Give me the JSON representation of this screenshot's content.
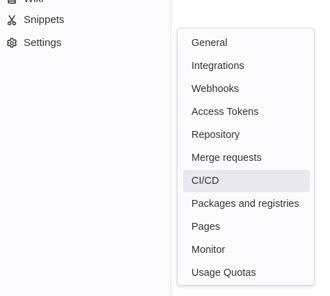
{
  "sidebar": {
    "items": [
      {
        "label": "Wiki",
        "icon": "book-icon"
      },
      {
        "label": "Snippets",
        "icon": "scissors-icon"
      },
      {
        "label": "Settings",
        "icon": "gear-icon"
      }
    ]
  },
  "flyout": {
    "items": [
      {
        "label": "General"
      },
      {
        "label": "Integrations"
      },
      {
        "label": "Webhooks"
      },
      {
        "label": "Access Tokens"
      },
      {
        "label": "Repository"
      },
      {
        "label": "Merge requests"
      },
      {
        "label": "CI/CD",
        "active": true
      },
      {
        "label": "Packages and registries"
      },
      {
        "label": "Pages"
      },
      {
        "label": "Monitor"
      },
      {
        "label": "Usage Quotas"
      }
    ]
  },
  "colors": {
    "sidebar_bg": "#fbfafd",
    "text": "#333238",
    "active_bg": "#e9e8ee",
    "border": "#dcdcde"
  }
}
